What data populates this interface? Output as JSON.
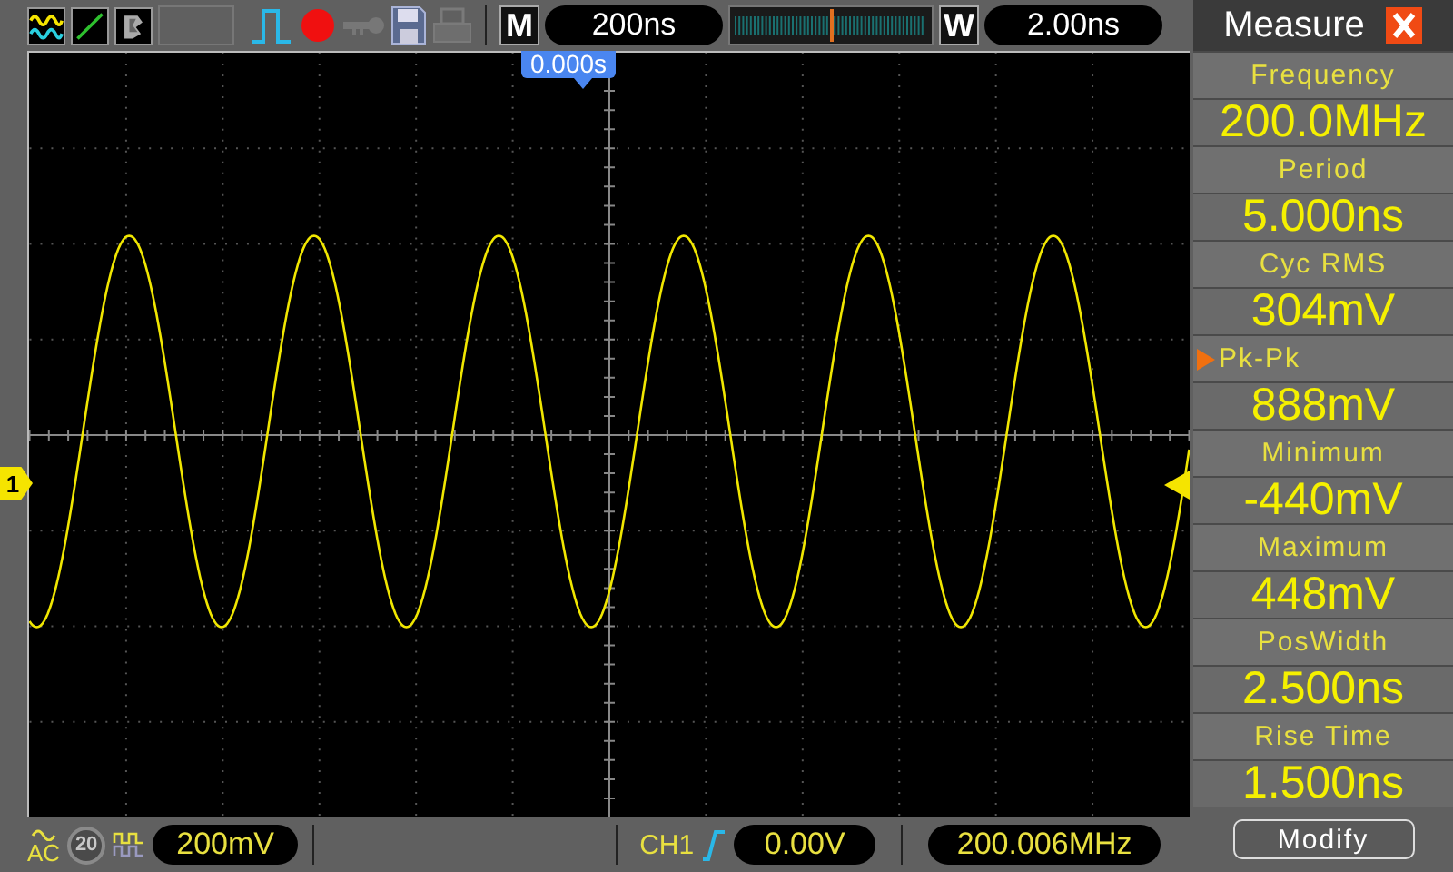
{
  "toolbar": {
    "timebase_label": "M",
    "timebase": "200ns",
    "window_label": "W",
    "window_timebase": "2.00ns",
    "trigger_position": "0.000s"
  },
  "channel_marker": "1",
  "bottom": {
    "coupling": "AC",
    "bandwidth_limit": {
      "label": "20",
      "on": false
    },
    "volts_div": "200mV",
    "trigger_source": "CH1",
    "trigger_level": "0.00V",
    "frequency": "200.006MHz"
  },
  "measure": {
    "title": "Measure",
    "items": [
      {
        "label": "Frequency",
        "value": "200.0MHz",
        "selected": false
      },
      {
        "label": "Period",
        "value": "5.000ns",
        "selected": false
      },
      {
        "label": "Cyc RMS",
        "value": "304mV",
        "selected": false
      },
      {
        "label": "Pk-Pk",
        "value": "888mV",
        "selected": true
      },
      {
        "label": "Minimum",
        "value": "-440mV",
        "selected": false
      },
      {
        "label": "Maximum",
        "value": "448mV",
        "selected": false
      },
      {
        "label": "PosWidth",
        "value": "2.500ns",
        "selected": false
      },
      {
        "label": "Rise Time",
        "value": "1.500ns",
        "selected": false
      }
    ],
    "button": "Modify"
  }
}
